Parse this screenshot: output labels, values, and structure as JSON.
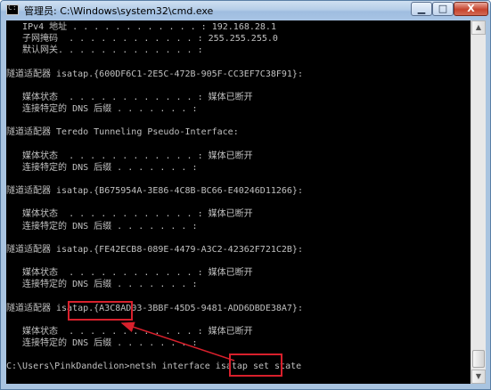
{
  "window": {
    "title": "管理员: C:\\Windows\\system32\\cmd.exe",
    "icon_text": "C:\\",
    "controls": {
      "minimize": "▁",
      "maximize": "□",
      "close": "X"
    }
  },
  "console": {
    "lines": [
      "   IPv4 地址 . . . . . . . . . . . . : 192.168.28.1",
      "   子网掩码  . . . . . . . . . . . . : 255.255.255.0",
      "   默认网关. . . . . . . . . . . . . :",
      "",
      "隧道适配器 isatap.{600DF6C1-2E5C-472B-905F-CC3EF7C38F91}:",
      "",
      "   媒体状态  . . . . . . . . . . . . : 媒体已断开",
      "   连接特定的 DNS 后缀 . . . . . . . :",
      "",
      "隧道适配器 Teredo Tunneling Pseudo-Interface:",
      "",
      "   媒体状态  . . . . . . . . . . . . : 媒体已断开",
      "   连接特定的 DNS 后缀 . . . . . . . :",
      "",
      "隧道适配器 isatap.{B675954A-3E86-4C8B-BC66-E40246D11266}:",
      "",
      "   媒体状态  . . . . . . . . . . . . : 媒体已断开",
      "   连接特定的 DNS 后缀 . . . . . . . :",
      "",
      "隧道适配器 isatap.{FE42ECB8-089E-4479-A3C2-42362F721C2B}:",
      "",
      "   媒体状态  . . . . . . . . . . . . : 媒体已断开",
      "   连接特定的 DNS 后缀 . . . . . . . :",
      "",
      "隧道适配器 isatap.{A3C8AD03-3BBF-45D5-9481-ADD6DBDE38A7}:",
      "",
      "   媒体状态  . . . . . . . . . . . . : 媒体已断开",
      "   连接特定的 DNS 后缀 . . . . . . . :",
      "",
      "C:\\Users\\PinkDandelion>netsh interface isatap set state"
    ]
  },
  "scrollbar": {
    "up_glyph": "▲",
    "down_glyph": "▼"
  },
  "colors": {
    "console_bg": "#000000",
    "console_text": "#c0c0c0",
    "highlight": "#d8202c",
    "titlebar": "#b5cde8"
  }
}
